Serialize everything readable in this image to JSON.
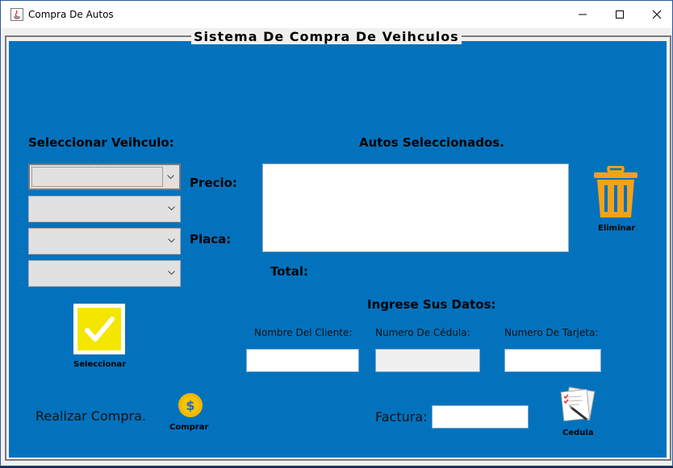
{
  "window": {
    "title": "Compra De Autos"
  },
  "panel": {
    "title": "Sistema De Compra De Veihculos",
    "bg_color": "#0372bd"
  },
  "labels": {
    "select_vehicle": "Seleccionar Veihculo:",
    "selected_cars": "Autos Seleccionados.",
    "price": "Precio:",
    "plate": "Placa:",
    "total": "Total:",
    "enter_data": "Ingrese Sus Datos:",
    "client_name": "Nombre Del Cliente:",
    "id_number": "Numero De Cédula:",
    "card_number": "Numero De Tarjeta:",
    "make_purchase": "Realizar Compra.",
    "invoice": "Factura:"
  },
  "combos": [
    {
      "selected": ""
    },
    {
      "selected": ""
    },
    {
      "selected": ""
    },
    {
      "selected": ""
    }
  ],
  "fields": {
    "client_name": "",
    "id_number": "",
    "card_number": "",
    "invoice": ""
  },
  "buttons": {
    "select": {
      "label": "Seleccionar",
      "icon": "checkmark-icon"
    },
    "delete": {
      "label": "Eliminar",
      "icon": "trash-icon"
    },
    "buy": {
      "label": "Comprar",
      "icon": "dollar-coin-icon"
    },
    "id_card": {
      "label": "Cedula",
      "icon": "document-pen-icon"
    }
  },
  "colors": {
    "accent_yellow": "#f5e600",
    "trash_orange": "#f3a21a",
    "coin_gold": "#f2b600"
  }
}
